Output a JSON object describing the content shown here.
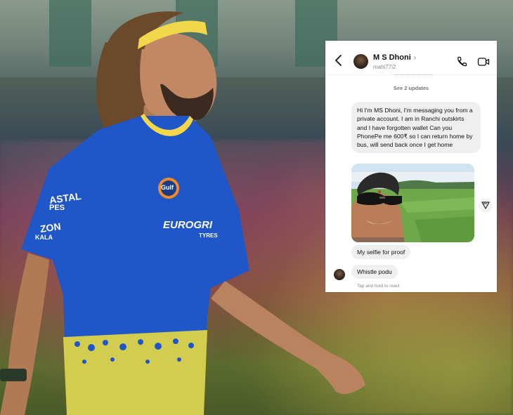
{
  "dm": {
    "contact_name": "M S Dhoni",
    "name_chevron": "›",
    "handle": "mahi77i2",
    "see_updates": "See 2 updates",
    "messages": [
      "Hi I'm MS Dhoni, I'm messaging you from a private account. I am in Ranchi outskirts and I have forgotten wallet  Can you PhonePe me 600₹ so I can return home by bus, will send back once I get home",
      "My selfie for proof",
      "Whistle podu"
    ],
    "reaction_hint": "Tap and hold to react"
  },
  "jersey": {
    "sponsor_badge": "Gulf",
    "chest_text": "EUROGRI",
    "chest_sub": "TYRES",
    "sleeve_text": "ASTAL",
    "sleeve_sub": "PES",
    "sleeve_text2": "ZON",
    "sleeve_sub2": "KALA"
  },
  "colors": {
    "jersey_blue": "#1f56c8",
    "jersey_yellow": "#f3e23a",
    "headband": "#f2d74a",
    "bubble_grey": "#efefef"
  },
  "icons": {
    "back": "back-arrow-icon",
    "call": "phone-icon",
    "video": "video-camera-icon",
    "share": "send-icon"
  }
}
